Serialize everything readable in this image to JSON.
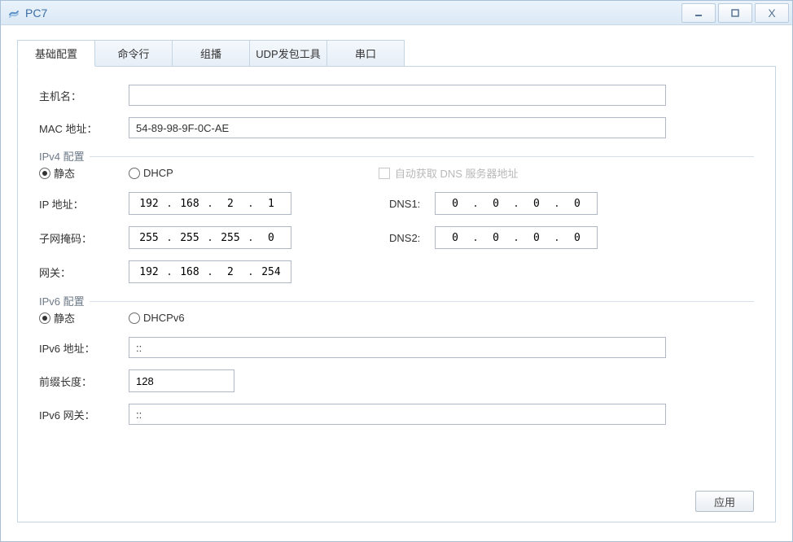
{
  "window": {
    "title": "PC7"
  },
  "tabs": [
    {
      "label": "基础配置",
      "active": true
    },
    {
      "label": "命令行",
      "active": false
    },
    {
      "label": "组播",
      "active": false
    },
    {
      "label": "UDP发包工具",
      "active": false
    },
    {
      "label": "串口",
      "active": false
    }
  ],
  "basic": {
    "hostname_label": "主机名：",
    "hostname_value": "",
    "mac_label": "MAC 地址：",
    "mac_value": "54-89-98-9F-0C-AE"
  },
  "ipv4": {
    "legend": "IPv4 配置",
    "static_label": "静态",
    "static_checked": true,
    "dhcp_label": "DHCP",
    "dhcp_checked": false,
    "auto_dns_label": "自动获取 DNS 服务器地址",
    "auto_dns_checked": false,
    "ip_label": "IP 地址：",
    "ip_octets": [
      "192",
      "168",
      "2",
      "1"
    ],
    "mask_label": "子网掩码：",
    "mask_octets": [
      "255",
      "255",
      "255",
      "0"
    ],
    "gw_label": "网关：",
    "gw_octets": [
      "192",
      "168",
      "2",
      "254"
    ],
    "dns1_label": "DNS1:",
    "dns1_octets": [
      "0",
      "0",
      "0",
      "0"
    ],
    "dns2_label": "DNS2:",
    "dns2_octets": [
      "0",
      "0",
      "0",
      "0"
    ]
  },
  "ipv6": {
    "legend": "IPv6 配置",
    "static_label": "静态",
    "static_checked": true,
    "dhcpv6_label": "DHCPv6",
    "dhcpv6_checked": false,
    "addr_label": "IPv6 地址：",
    "addr_value": "::",
    "prefix_label": "前缀长度：",
    "prefix_value": "128",
    "gw_label": "IPv6 网关：",
    "gw_value": "::"
  },
  "buttons": {
    "apply": "应用"
  }
}
